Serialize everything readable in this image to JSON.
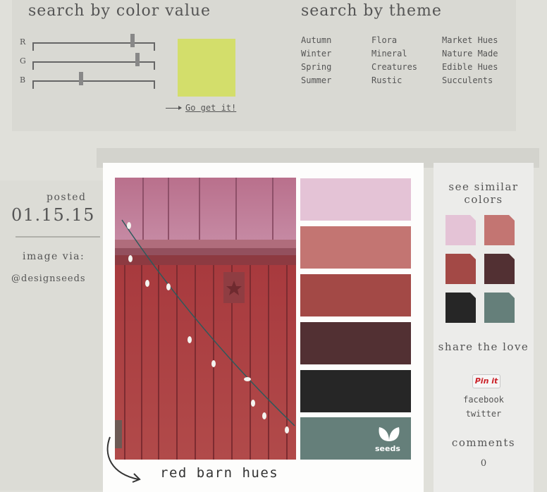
{
  "colorSearch": {
    "title": "search by color value",
    "sliders": [
      {
        "label": "R",
        "value": 211
      },
      {
        "label": "G",
        "value": 222
      },
      {
        "label": "B",
        "value": 100
      }
    ],
    "swatchColor": "#d3de6b",
    "goLabel": "Go get it!"
  },
  "themeSearch": {
    "title": "search by theme",
    "columns": [
      [
        "Autumn",
        "Winter",
        "Spring",
        "Summer"
      ],
      [
        "Flora",
        "Mineral",
        "Creatures",
        "Rustic"
      ],
      [
        "Market Hues",
        "Nature Made",
        "Edible Hues",
        "Succulents"
      ]
    ]
  },
  "post": {
    "postedLabel": "posted",
    "date": "01.15.15",
    "imageViaLabel": "image via:",
    "imageVia": "@designseeds",
    "caption": "red barn hues",
    "logoText": "seeds",
    "palette": [
      "#e4c3d6",
      "#c37572",
      "#a34946",
      "#523033",
      "#262626",
      "#657f7a"
    ]
  },
  "sidebar": {
    "similarTitle": "see similar colors",
    "similarColors": [
      "#e4c3d6",
      "#c37572",
      "#a34946",
      "#523033",
      "#262626",
      "#657f7a"
    ],
    "shareTitle": "share the love",
    "pinLabel": "Pin it",
    "facebook": "facebook",
    "twitter": "twitter",
    "commentsTitle": "comments",
    "commentsCount": "0"
  }
}
